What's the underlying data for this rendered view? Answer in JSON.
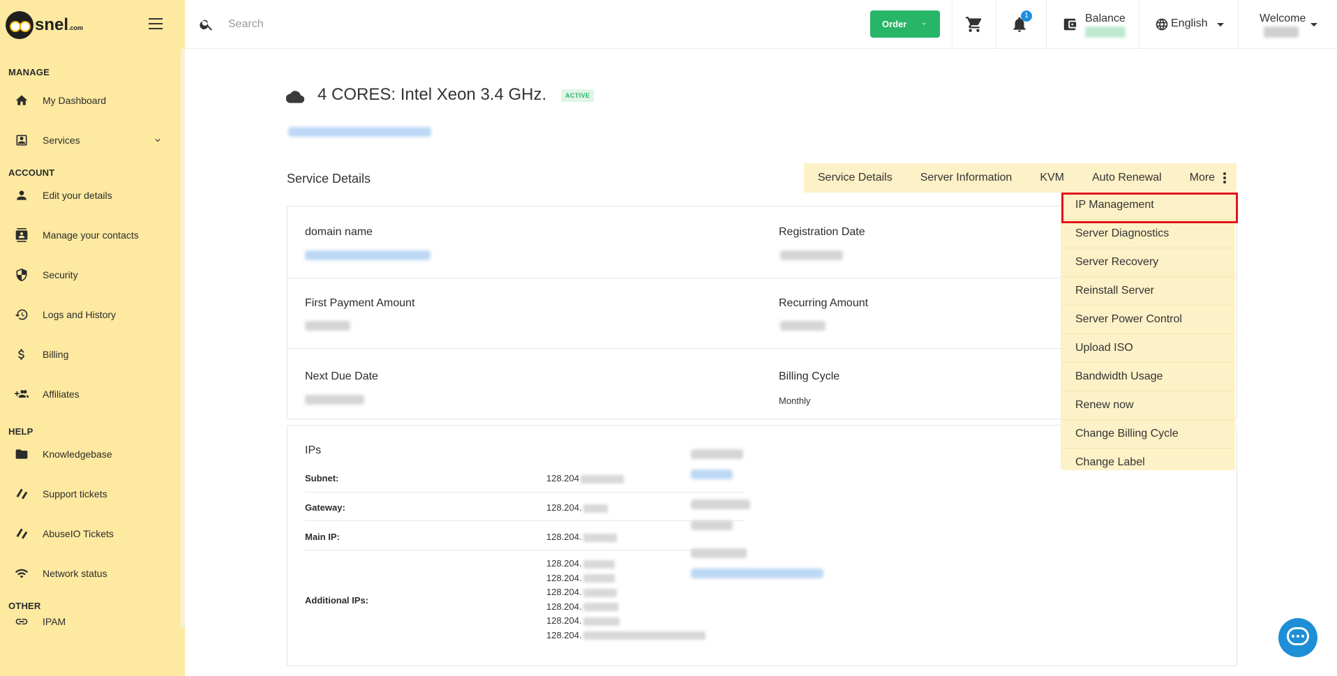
{
  "brand": {
    "name": "snel",
    "suffix": ".com"
  },
  "sidebar": {
    "sections": [
      {
        "title": "MANAGE",
        "items": [
          {
            "label": "My Dashboard",
            "icon": "home-icon"
          },
          {
            "label": "Services",
            "icon": "id-card-icon",
            "expandable": true
          }
        ]
      },
      {
        "title": "ACCOUNT",
        "items": [
          {
            "label": "Edit your details",
            "icon": "person-icon"
          },
          {
            "label": "Manage your contacts",
            "icon": "contacts-icon"
          },
          {
            "label": "Security",
            "icon": "shield-icon"
          },
          {
            "label": "Logs and History",
            "icon": "history-icon"
          },
          {
            "label": "Billing",
            "icon": "dollar-icon"
          },
          {
            "label": "Affiliates",
            "icon": "group-add-icon"
          }
        ]
      },
      {
        "title": "HELP",
        "items": [
          {
            "label": "Knowledgebase",
            "icon": "folder-icon"
          },
          {
            "label": "Support tickets",
            "icon": "ticket-icon"
          },
          {
            "label": "AbuseIO Tickets",
            "icon": "ticket-icon"
          },
          {
            "label": "Network status",
            "icon": "wifi-icon"
          }
        ]
      },
      {
        "title": "OTHER",
        "items": [
          {
            "label": "IPAM",
            "icon": "link-icon"
          }
        ]
      }
    ]
  },
  "topbar": {
    "search_placeholder": "Search",
    "order_label": "Order",
    "notifications_count": "1",
    "balance_label": "Balance",
    "language": "English",
    "welcome_label": "Welcome"
  },
  "service": {
    "title": "4 CORES: Intel Xeon 3.4 GHz.",
    "status": "ACTIVE",
    "section_heading": "Service Details"
  },
  "tabs": [
    "Service Details",
    "Server Information",
    "KVM",
    "Auto Renewal",
    "More"
  ],
  "details": {
    "domain_label": "domain name",
    "registration_label": "Registration Date",
    "first_payment_label": "First Payment Amount",
    "recurring_label": "Recurring Amount",
    "next_due_label": "Next Due Date",
    "billing_cycle_label": "Billing Cycle",
    "billing_cycle_value": "Monthly"
  },
  "ips": {
    "title": "IPs",
    "subnet_label": "Subnet:",
    "subnet_value": "128.204",
    "gateway_label": "Gateway:",
    "gateway_value": "128.204.",
    "main_ip_label": "Main IP:",
    "main_ip_value": "128.204.",
    "additional_label": "Additional IPs:",
    "additional_values": [
      "128.204.",
      "128.204.",
      "128.204.",
      "128.204.",
      "128.204.",
      "128.204."
    ]
  },
  "more_menu": [
    "IP Management",
    "Server Diagnostics",
    "Server Recovery",
    "Reinstall Server",
    "Server Power Control",
    "Upload ISO",
    "Bandwidth Usage",
    "Renew now",
    "Change Billing Cycle",
    "Change Label"
  ],
  "colors": {
    "sidebar_bg": "#fde9a0",
    "order_green": "#27b567",
    "highlight_red": "#e3141b",
    "chat_blue": "#1e8fd6",
    "menu_bg": "#fdf1c7"
  }
}
